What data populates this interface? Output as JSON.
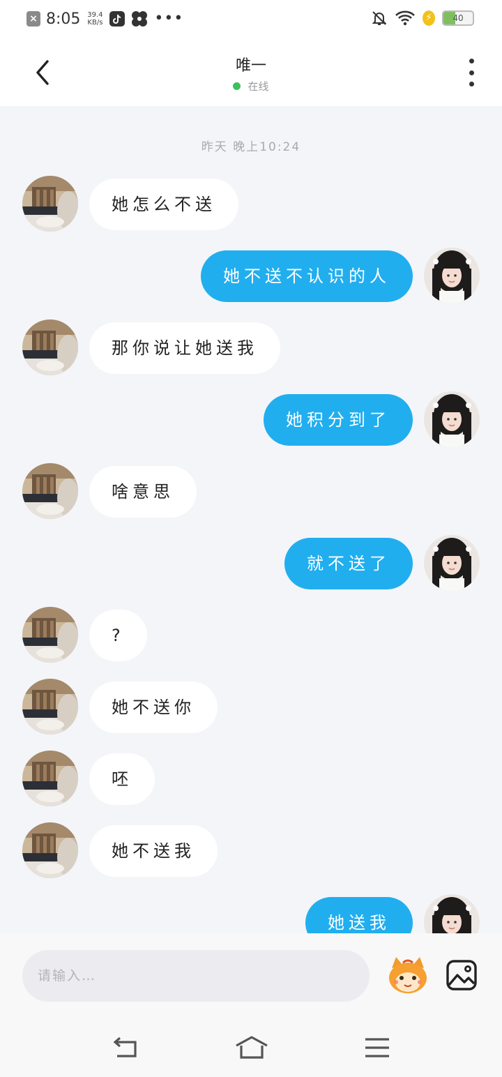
{
  "status_bar": {
    "time": "8:05",
    "net_speed": "39.4",
    "net_unit": "KB/s",
    "battery": "40",
    "battery_level": 0.4
  },
  "header": {
    "title": "唯一",
    "status": "在线",
    "status_color": "#3ac25d"
  },
  "chat": {
    "timestamp": "昨天 晚上10:24",
    "messages": [
      {
        "side": "left",
        "text": "她怎么不送"
      },
      {
        "side": "right",
        "text": "她不送不认识的人"
      },
      {
        "side": "left",
        "text": "那你说让她送我"
      },
      {
        "side": "right",
        "text": "她积分到了"
      },
      {
        "side": "left",
        "text": "啥意思"
      },
      {
        "side": "right",
        "text": "就不送了"
      },
      {
        "side": "left",
        "text": "?"
      },
      {
        "side": "left",
        "text": "她不送你"
      },
      {
        "side": "left",
        "text": "呸"
      },
      {
        "side": "left",
        "text": "她不送我"
      },
      {
        "side": "right",
        "text": "她送我"
      }
    ],
    "sent_bubble_color": "#21aeef",
    "received_bubble_color": "#ffffff"
  },
  "input": {
    "placeholder": "请输入…",
    "value": ""
  },
  "icons": {
    "back": "chevron-left-icon",
    "more": "more-vertical-icon",
    "emoji": "emoji-mascot-icon",
    "image": "image-icon"
  }
}
